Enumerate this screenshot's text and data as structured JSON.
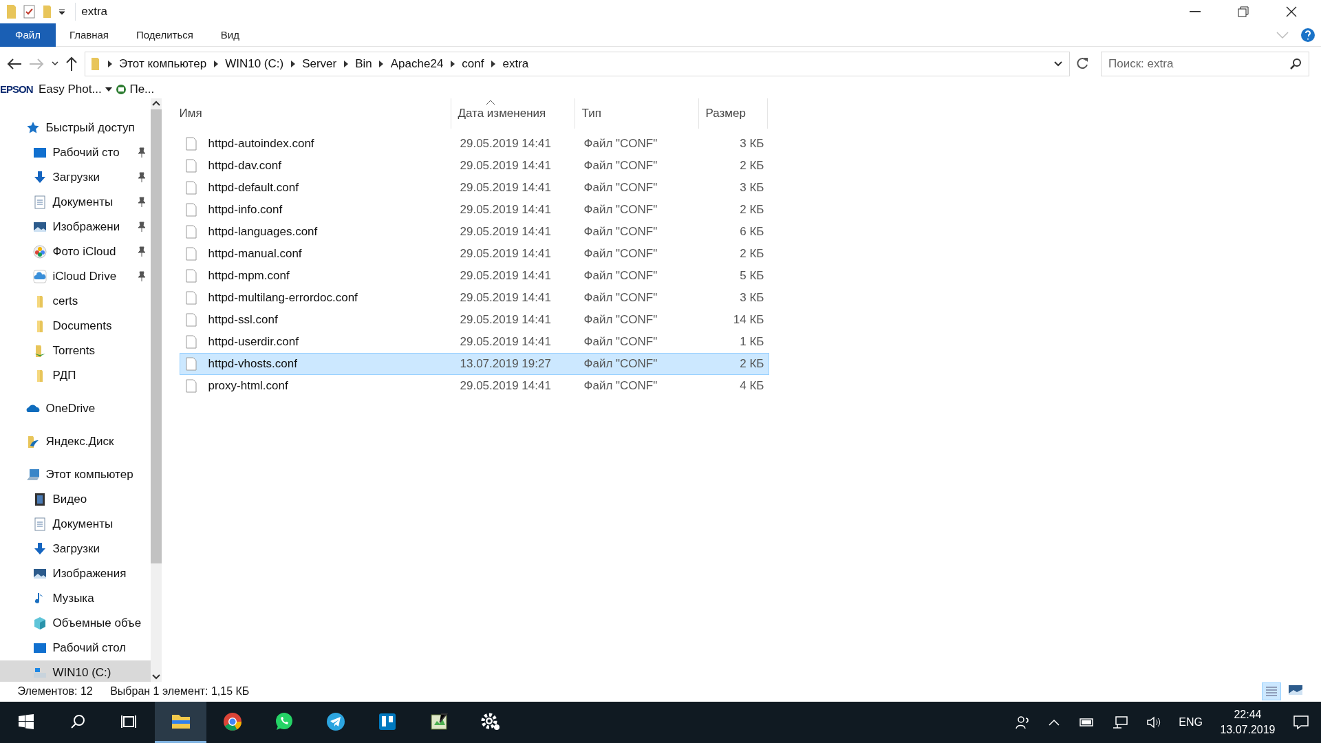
{
  "window": {
    "title": "extra"
  },
  "ribbon_tabs": [
    {
      "label": "Файл",
      "selected": true
    },
    {
      "label": "Главная",
      "selected": false
    },
    {
      "label": "Поделиться",
      "selected": false
    },
    {
      "label": "Вид",
      "selected": false
    }
  ],
  "breadcrumb": [
    "Этот компьютер",
    "WIN10 (C:)",
    "Server",
    "Bin",
    "Apache24",
    "conf",
    "extra"
  ],
  "search": {
    "placeholder": "Поиск: extra"
  },
  "toolbar": {
    "epson": "EPSON",
    "app": "Easy Phot...",
    "more": "Пе..."
  },
  "sidebar": [
    {
      "label": "Быстрый доступ",
      "kind": "star",
      "children": [
        {
          "label": "Рабочий сто",
          "kind": "desktop",
          "pinned": true
        },
        {
          "label": "Загрузки",
          "kind": "download",
          "pinned": true
        },
        {
          "label": "Документы",
          "kind": "document",
          "pinned": true
        },
        {
          "label": "Изображени",
          "kind": "picture",
          "pinned": true
        },
        {
          "label": "Фото iCloud",
          "kind": "photos",
          "pinned": true
        },
        {
          "label": "iCloud Drive",
          "kind": "cloud",
          "pinned": true
        },
        {
          "label": "certs",
          "kind": "folder",
          "pinned": false
        },
        {
          "label": "Documents",
          "kind": "folder",
          "pinned": false
        },
        {
          "label": "Torrents",
          "kind": "torrent",
          "pinned": false
        },
        {
          "label": "РДП",
          "kind": "folder",
          "pinned": false
        }
      ]
    },
    {
      "label": "OneDrive",
      "kind": "onedrive"
    },
    {
      "label": "Яндекс.Диск",
      "kind": "yadisk"
    },
    {
      "label": "Этот компьютер",
      "kind": "pc",
      "children": [
        {
          "label": "Видео",
          "kind": "video",
          "pinned": false
        },
        {
          "label": "Документы",
          "kind": "document",
          "pinned": false
        },
        {
          "label": "Загрузки",
          "kind": "download",
          "pinned": false
        },
        {
          "label": "Изображения",
          "kind": "picture",
          "pinned": false
        },
        {
          "label": "Музыка",
          "kind": "music",
          "pinned": false
        },
        {
          "label": "Объемные объе",
          "kind": "cube",
          "pinned": false
        },
        {
          "label": "Рабочий стол",
          "kind": "desktop",
          "pinned": false
        },
        {
          "label": "WIN10 (C:)",
          "kind": "drive",
          "pinned": false,
          "selected": true
        }
      ]
    }
  ],
  "table": {
    "columns": [
      "Имя",
      "Дата изменения",
      "Тип",
      "Размер"
    ],
    "rows": [
      {
        "name": "httpd-autoindex.conf",
        "date": "29.05.2019 14:41",
        "type": "Файл \"CONF\"",
        "size": "3 КБ",
        "selected": false
      },
      {
        "name": "httpd-dav.conf",
        "date": "29.05.2019 14:41",
        "type": "Файл \"CONF\"",
        "size": "2 КБ",
        "selected": false
      },
      {
        "name": "httpd-default.conf",
        "date": "29.05.2019 14:41",
        "type": "Файл \"CONF\"",
        "size": "3 КБ",
        "selected": false
      },
      {
        "name": "httpd-info.conf",
        "date": "29.05.2019 14:41",
        "type": "Файл \"CONF\"",
        "size": "2 КБ",
        "selected": false
      },
      {
        "name": "httpd-languages.conf",
        "date": "29.05.2019 14:41",
        "type": "Файл \"CONF\"",
        "size": "6 КБ",
        "selected": false
      },
      {
        "name": "httpd-manual.conf",
        "date": "29.05.2019 14:41",
        "type": "Файл \"CONF\"",
        "size": "2 КБ",
        "selected": false
      },
      {
        "name": "httpd-mpm.conf",
        "date": "29.05.2019 14:41",
        "type": "Файл \"CONF\"",
        "size": "5 КБ",
        "selected": false
      },
      {
        "name": "httpd-multilang-errordoc.conf",
        "date": "29.05.2019 14:41",
        "type": "Файл \"CONF\"",
        "size": "3 КБ",
        "selected": false
      },
      {
        "name": "httpd-ssl.conf",
        "date": "29.05.2019 14:41",
        "type": "Файл \"CONF\"",
        "size": "14 КБ",
        "selected": false
      },
      {
        "name": "httpd-userdir.conf",
        "date": "29.05.2019 14:41",
        "type": "Файл \"CONF\"",
        "size": "1 КБ",
        "selected": false
      },
      {
        "name": "httpd-vhosts.conf",
        "date": "13.07.2019 19:27",
        "type": "Файл \"CONF\"",
        "size": "2 КБ",
        "selected": true
      },
      {
        "name": "proxy-html.conf",
        "date": "29.05.2019 14:41",
        "type": "Файл \"CONF\"",
        "size": "4 КБ",
        "selected": false
      }
    ]
  },
  "status_bar": {
    "count": "Элементов: 12",
    "selection": "Выбран 1 элемент: 1,15 КБ"
  },
  "taskbar": {
    "apps": [
      {
        "kind": "explorer",
        "selected": true
      },
      {
        "kind": "chrome",
        "selected": false
      },
      {
        "kind": "whatsapp",
        "selected": false
      },
      {
        "kind": "telegram",
        "selected": false
      },
      {
        "kind": "trello",
        "selected": false
      },
      {
        "kind": "editor",
        "selected": false
      },
      {
        "kind": "gear",
        "selected": false
      }
    ],
    "language": "ENG",
    "time": "22:44",
    "date": "13.07.2019"
  }
}
